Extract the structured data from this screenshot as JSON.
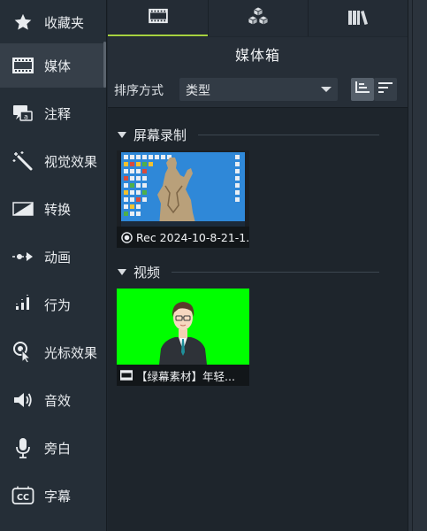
{
  "sidebar": {
    "items": [
      {
        "label": "收藏夹",
        "icon": "star-icon"
      },
      {
        "label": "媒体",
        "icon": "film-icon",
        "active": true
      },
      {
        "label": "注释",
        "icon": "annotation-icon"
      },
      {
        "label": "视觉效果",
        "icon": "magic-wand-icon"
      },
      {
        "label": "转换",
        "icon": "transition-icon"
      },
      {
        "label": "动画",
        "icon": "animation-arrow-icon"
      },
      {
        "label": "行为",
        "icon": "behavior-icon"
      },
      {
        "label": "光标效果",
        "icon": "cursor-effect-icon"
      },
      {
        "label": "音效",
        "icon": "speaker-icon"
      },
      {
        "label": "旁白",
        "icon": "microphone-icon"
      },
      {
        "label": "字幕",
        "icon": "captions-icon"
      }
    ]
  },
  "tabs": [
    {
      "icon": "media-bin-tab-icon",
      "active": true
    },
    {
      "icon": "library-cubes-tab-icon",
      "active": false
    },
    {
      "icon": "books-tab-icon",
      "active": false
    }
  ],
  "panel": {
    "title": "媒体箱",
    "sort_label": "排序方式",
    "sort_value": "类型",
    "view_buttons": [
      "details-view-icon",
      "sort-order-icon"
    ]
  },
  "sections": [
    {
      "title": "屏幕录制",
      "clips": [
        {
          "caption": "Rec 2024-10-8-21-1...",
          "type_icon": "recording-icon"
        }
      ]
    },
    {
      "title": "视频",
      "clips": [
        {
          "caption": "【绿幕素材】年轻...",
          "type_icon": "video-clip-icon"
        }
      ]
    }
  ],
  "colors": {
    "accent_green": "#a6d13f",
    "green_screen": "#00ff00",
    "desktop_blue": "#2f88d8",
    "sidebar_bg": "#252e37",
    "panel_bg": "#1e252c"
  }
}
